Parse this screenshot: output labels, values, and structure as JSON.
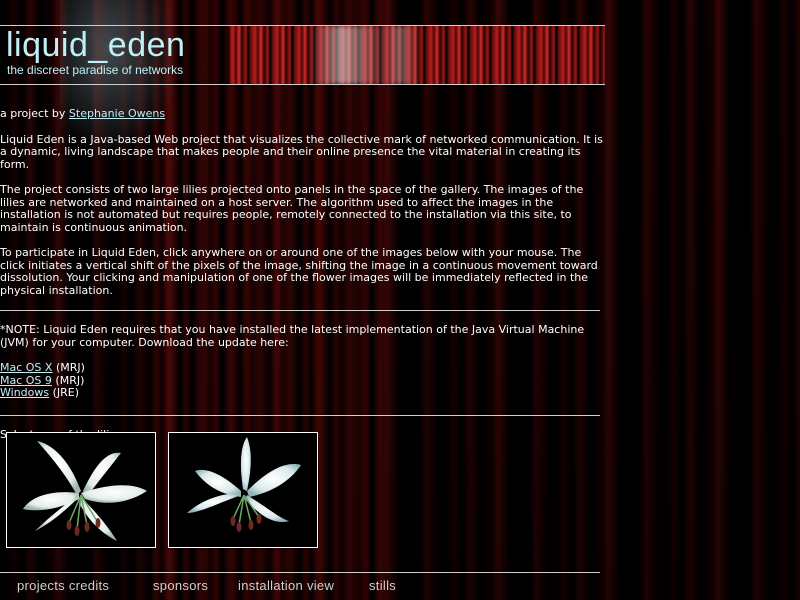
{
  "header": {
    "title": "liquid_eden",
    "tagline": "the discreet paradise of networks"
  },
  "content": {
    "project_prefix": "a project by ",
    "author_link": "Stephanie Owens",
    "paragraphs": [
      "Liquid Eden is a Java-based Web project that visualizes the collective mark of networked communication. It is a dynamic, living landscape that makes people and their online presence the vital material in creating its form.",
      "The project consists of two large lilies projected onto panels in the space of the gallery. The images of the lilies are networked and maintained on a host server. The algorithm used to affect the images in the installation is not automated but requires people, remotely connected to the installation via this site, to maintain is continuous animation.",
      "To participate in Liquid Eden, click anywhere on or around one of the images below with your mouse. The click initiates a vertical shift of the pixels of the image, shifting the image in a continuous movement toward dissolution. Your clicking and manipulation of one of the flower images will be immediately reflected in the physical installation."
    ],
    "note": "*NOTE: Liquid Eden requires that you have installed the latest implementation of the Java Virtual Machine (JVM) for your computer. Download the update here:",
    "downloads": [
      {
        "link": "Mac OS X",
        "suffix": " (MRJ)"
      },
      {
        "link": "Mac OS 9",
        "suffix": " (MRJ)"
      },
      {
        "link": "Windows",
        "suffix": " (JRE)"
      }
    ],
    "select_label": "Select one of the lilies :"
  },
  "footer": {
    "items": [
      "projects credits",
      "sponsors",
      "installation view",
      "stills"
    ]
  },
  "colors": {
    "accent": "#bff0f5",
    "text": "#ffffff",
    "background": "#000000",
    "rule": "#cfcfcf"
  }
}
